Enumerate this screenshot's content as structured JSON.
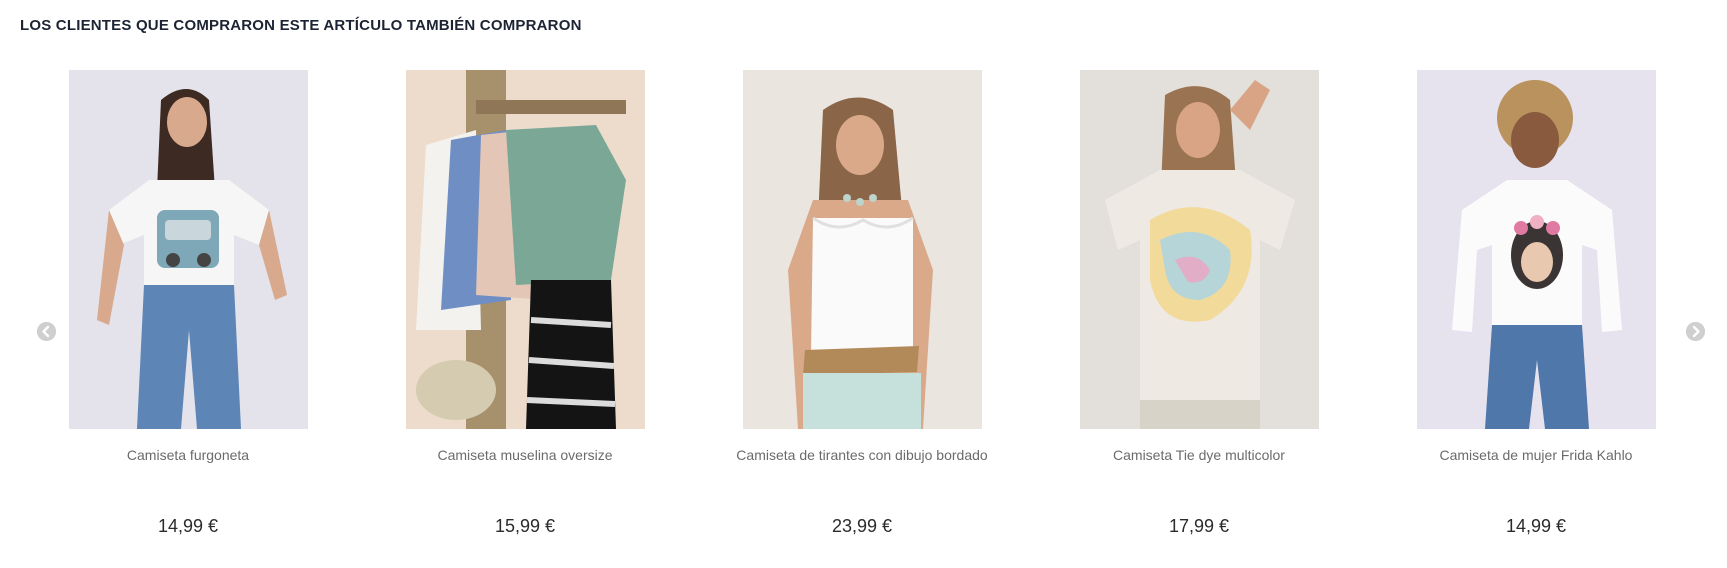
{
  "section": {
    "title": "LOS CLIENTES QUE COMPRARON ESTE ARTÍCULO TAMBIÉN COMPRARON"
  },
  "carousel": {
    "prev_icon": "chevron-left-icon",
    "next_icon": "chevron-right-icon",
    "products": [
      {
        "name": "Camiseta furgoneta",
        "price": "14,99 €",
        "bg": "#e4e2ea"
      },
      {
        "name": "Camiseta muselina oversize",
        "price": "15,99 €",
        "bg": "#eddccb"
      },
      {
        "name": "Camiseta de tirantes con dibujo bordado",
        "price": "23,99 €",
        "bg": "#ebe5e0"
      },
      {
        "name": "Camiseta Tie dye multicolor",
        "price": "17,99 €",
        "bg": "#e3e0dc"
      },
      {
        "name": "Camiseta de mujer Frida Kahlo",
        "price": "14,99 €",
        "bg": "#e6e3ef"
      }
    ]
  }
}
